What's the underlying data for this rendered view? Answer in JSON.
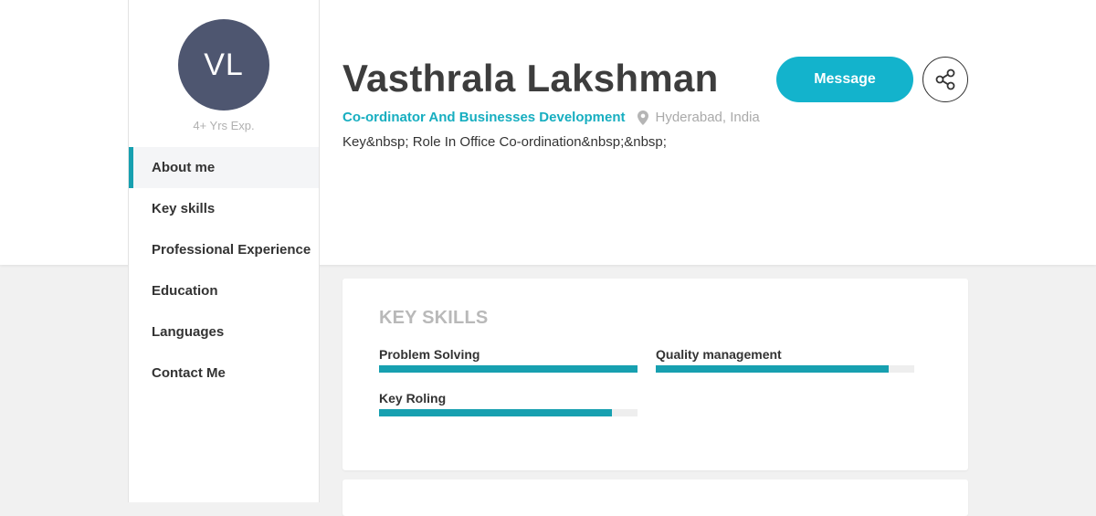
{
  "sidebar": {
    "avatar_initials": "VL",
    "experience": "4+ Yrs Exp.",
    "nav": [
      {
        "label": "About me",
        "active": true
      },
      {
        "label": "Key skills",
        "active": false
      },
      {
        "label": "Professional Experience",
        "active": false
      },
      {
        "label": "Education",
        "active": false
      },
      {
        "label": "Languages",
        "active": false
      },
      {
        "label": "Contact Me",
        "active": false
      }
    ]
  },
  "profile": {
    "name": "Vasthrala Lakshman",
    "role": "Co-ordinator And Businesses Development",
    "location_icon": "map-pin-icon",
    "location": "Hyderabad, India",
    "summary": "Key&nbsp; Role In Office Co-ordination&nbsp;&nbsp;"
  },
  "actions": {
    "message_label": "Message",
    "share_icon": "share-icon"
  },
  "key_skills": {
    "title": "KEY SKILLS",
    "skills": [
      {
        "name": "Problem Solving",
        "level": 1.0
      },
      {
        "name": "Quality management",
        "level": 0.9
      },
      {
        "name": "Key Roling",
        "level": 0.9
      }
    ]
  },
  "colors": {
    "accent": "#17a0b0",
    "button": "#13b3cc",
    "avatar": "#4e5670"
  }
}
